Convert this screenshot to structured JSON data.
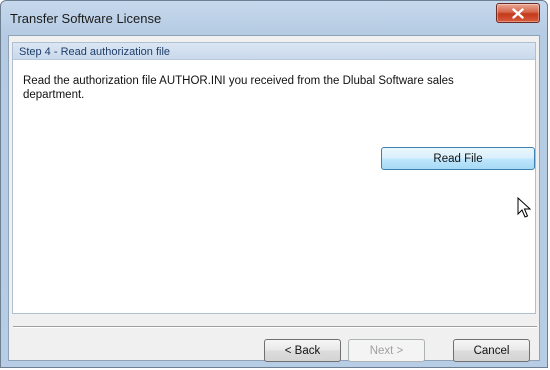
{
  "window": {
    "title": "Transfer Software License",
    "close_icon": "close-icon"
  },
  "step": {
    "title": "Step 4 - Read authorization file",
    "description": "Read the authorization file AUTHOR.INI you received from the Dlubal Software sales department."
  },
  "buttons": {
    "read_file": "Read File",
    "back": "< Back",
    "next": "Next >",
    "cancel": "Cancel"
  },
  "states": {
    "read_file": "hover",
    "next": "disabled"
  },
  "cursor": "arrow-cursor-icon",
  "colors": {
    "close_button": "#c4391c",
    "header_band": "#c9d9ec",
    "hover_button": "#bee6fd"
  }
}
